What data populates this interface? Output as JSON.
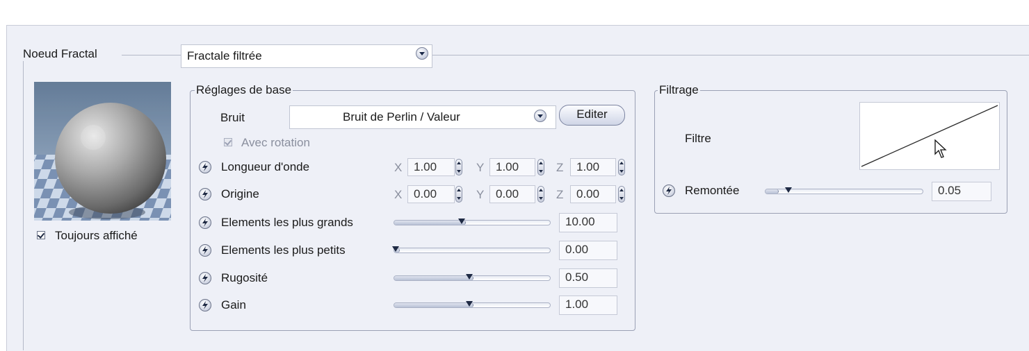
{
  "node": {
    "label": "Noeud Fractal",
    "type_selected": "Fractale filtrée",
    "always_show_label": "Toujours affiché",
    "always_show_checked": true
  },
  "base": {
    "title": "Réglages de base",
    "noise_label": "Bruit",
    "noise_value": "Bruit de Perlin / Valeur",
    "edit_button": "Editer",
    "rotation_label": "Avec rotation",
    "rotation_checked": true,
    "wavelength": {
      "label": "Longueur d'onde",
      "x": "1.00",
      "y": "1.00",
      "z": "1.00"
    },
    "origin": {
      "label": "Origine",
      "x": "0.00",
      "y": "0.00",
      "z": "0.00"
    },
    "axis_x": "X",
    "axis_y": "Y",
    "axis_z": "Z",
    "sliders": [
      {
        "label": "Elements les plus grands",
        "value": "10.00",
        "level": 0.45
      },
      {
        "label": "Elements les plus petits",
        "value": "0.00",
        "level": 0.03
      },
      {
        "label": "Rugosité",
        "value": "0.50",
        "level": 0.5
      },
      {
        "label": "Gain",
        "value": "1.00",
        "level": 0.5
      }
    ]
  },
  "filter": {
    "title": "Filtrage",
    "filter_label": "Filtre",
    "rise_label": "Remontée",
    "rise_value": "0.05",
    "rise_level": 0.08
  },
  "icons": {
    "driver": "lightning-bolt-icon",
    "dropdown": "chevron-down-icon",
    "spinner": "up-down-spinner-icon",
    "cursor": "mouse-pointer-icon"
  },
  "colors": {
    "panel_bg": "#eef0f7",
    "field_bg": "#f7f8fc",
    "accent_dark": "#1f2a44"
  }
}
